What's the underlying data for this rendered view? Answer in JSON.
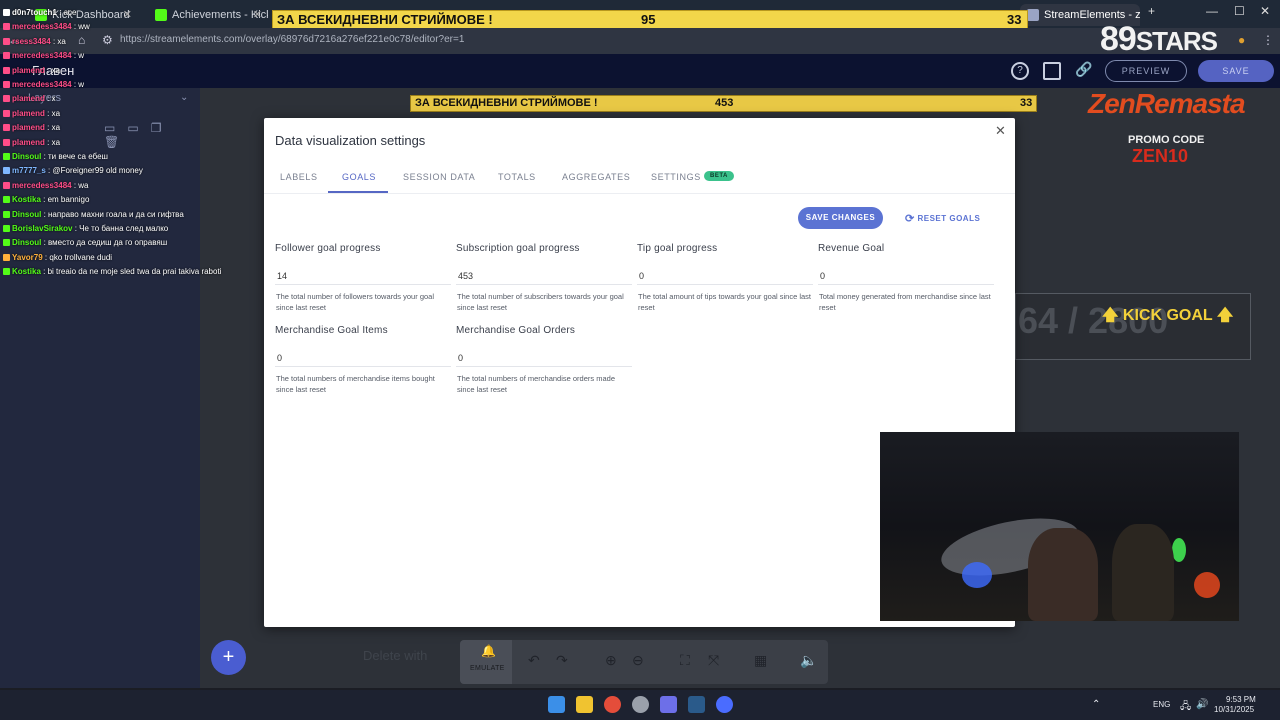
{
  "browser": {
    "tabs": [
      {
        "label": "Kick Dashboard",
        "color": "#53fc18"
      },
      {
        "label": "Achievements - Kick Da",
        "color": "#53fc18"
      },
      {
        "label": "StreamElements - zero",
        "color": "#9aa4c4"
      }
    ],
    "url": "https://streamelements.com/overlay/68976d7216a276ef221e0c78/editor?er=1"
  },
  "overlay": {
    "top_banner": {
      "label": "ЗА ВСЕКИДНЕВНИ СТРИЙМОВЕ !",
      "value1": "95",
      "value2": "33"
    },
    "canvas_banner": {
      "label": "ЗА ВСЕКИДНЕВНИ СТРИЙМОВЕ !",
      "value1": "453",
      "value2": "33"
    },
    "kick_goal": {
      "numbers": "64 / 2800",
      "label": "🡅 KICK GOAL 🡅"
    },
    "brand": {
      "top": "89",
      "stars": "STARS",
      "name": "ZenRemasta",
      "promo": "PROMO CODE",
      "code": "ZEN10"
    }
  },
  "editor": {
    "title": "Главен",
    "layers_title": "Layers",
    "preview_label": "PREVIEW",
    "save_label": "SAVE",
    "delete_hint": "Delete with",
    "emulate_label": "EMULATE"
  },
  "chat": [
    {
      "user": "d0n7touch1",
      "msg": "ace",
      "color": "#ffffff"
    },
    {
      "user": "mercedess3484",
      "msg": "ww",
      "color": "#ff4d88"
    },
    {
      "user": "rsess3484",
      "msg": "xa",
      "color": "#ff4d88"
    },
    {
      "user": "mercedess3484",
      "msg": "w",
      "color": "#ff4d88"
    },
    {
      "user": "plamend",
      "msg": "xa",
      "color": "#ff4d88"
    },
    {
      "user": "mercedess3484",
      "msg": "w",
      "color": "#ff4d88"
    },
    {
      "user": "plamend",
      "msg": "x",
      "color": "#ff4d88"
    },
    {
      "user": "plamend",
      "msg": "xa",
      "color": "#ff4d88"
    },
    {
      "user": "plamend",
      "msg": "xa",
      "color": "#ff4d88"
    },
    {
      "user": "plamend",
      "msg": "xa",
      "color": "#ff4d88"
    },
    {
      "user": "Dinsoul",
      "msg": "ти вече са ебеш",
      "color": "#53fc18"
    },
    {
      "user": "m7777_s",
      "msg": "@Foreigner99 old money",
      "color": "#7fb7ff"
    },
    {
      "user": "mercedess3484",
      "msg": "wa",
      "color": "#ff4d88"
    },
    {
      "user": "Kostika",
      "msg": "em bannigo",
      "color": "#53fc18"
    },
    {
      "user": "Dinsoul",
      "msg": "направо махни гоала и да си гифтва",
      "color": "#53fc18"
    },
    {
      "user": "BorislavSirakov",
      "msg": "Че то банна след малко",
      "color": "#53fc18"
    },
    {
      "user": "Dinsoul",
      "msg": "вместо да седиш да го оправяш",
      "color": "#53fc18"
    },
    {
      "user": "Yavor79",
      "msg": "qko trollvane dudi",
      "color": "#ffb13b"
    },
    {
      "user": "Kostika",
      "msg": "bi treaio da ne moje sled twa da prai takiva raboti",
      "color": "#53fc18"
    }
  ],
  "modal": {
    "title": "Data visualization settings",
    "tabs": [
      "LABELS",
      "GOALS",
      "SESSION DATA",
      "TOTALS",
      "AGGREGATES",
      "SETTINGS"
    ],
    "beta_badge": "BETA",
    "save_changes": "SAVE CHANGES",
    "reset_goals": "RESET GOALS",
    "fields": [
      {
        "label": "Follower goal progress",
        "value": "14",
        "help": "The total number of followers towards your goal since last reset"
      },
      {
        "label": "Subscription goal progress",
        "value": "453",
        "help": "The total number of subscribers towards your goal since last reset"
      },
      {
        "label": "Tip goal progress",
        "value": "0",
        "help": "The total amount of tips towards your goal since last reset"
      },
      {
        "label": "Revenue Goal",
        "value": "0",
        "help": "Total money generated from merchandise since last reset"
      },
      {
        "label": "Merchandise Goal Items",
        "value": "0",
        "help": "The total numbers of merchandise items bought since last reset"
      },
      {
        "label": "Merchandise Goal Orders",
        "value": "0",
        "help": "The total numbers of merchandise orders made since last reset"
      }
    ]
  },
  "taskbar": {
    "lang": "ENG",
    "time": "9:53 PM",
    "date": "10/31/2025"
  },
  "colors": {
    "accent": "#5667c4",
    "beta": "#3bc28c",
    "banner": "#f2d64a"
  }
}
